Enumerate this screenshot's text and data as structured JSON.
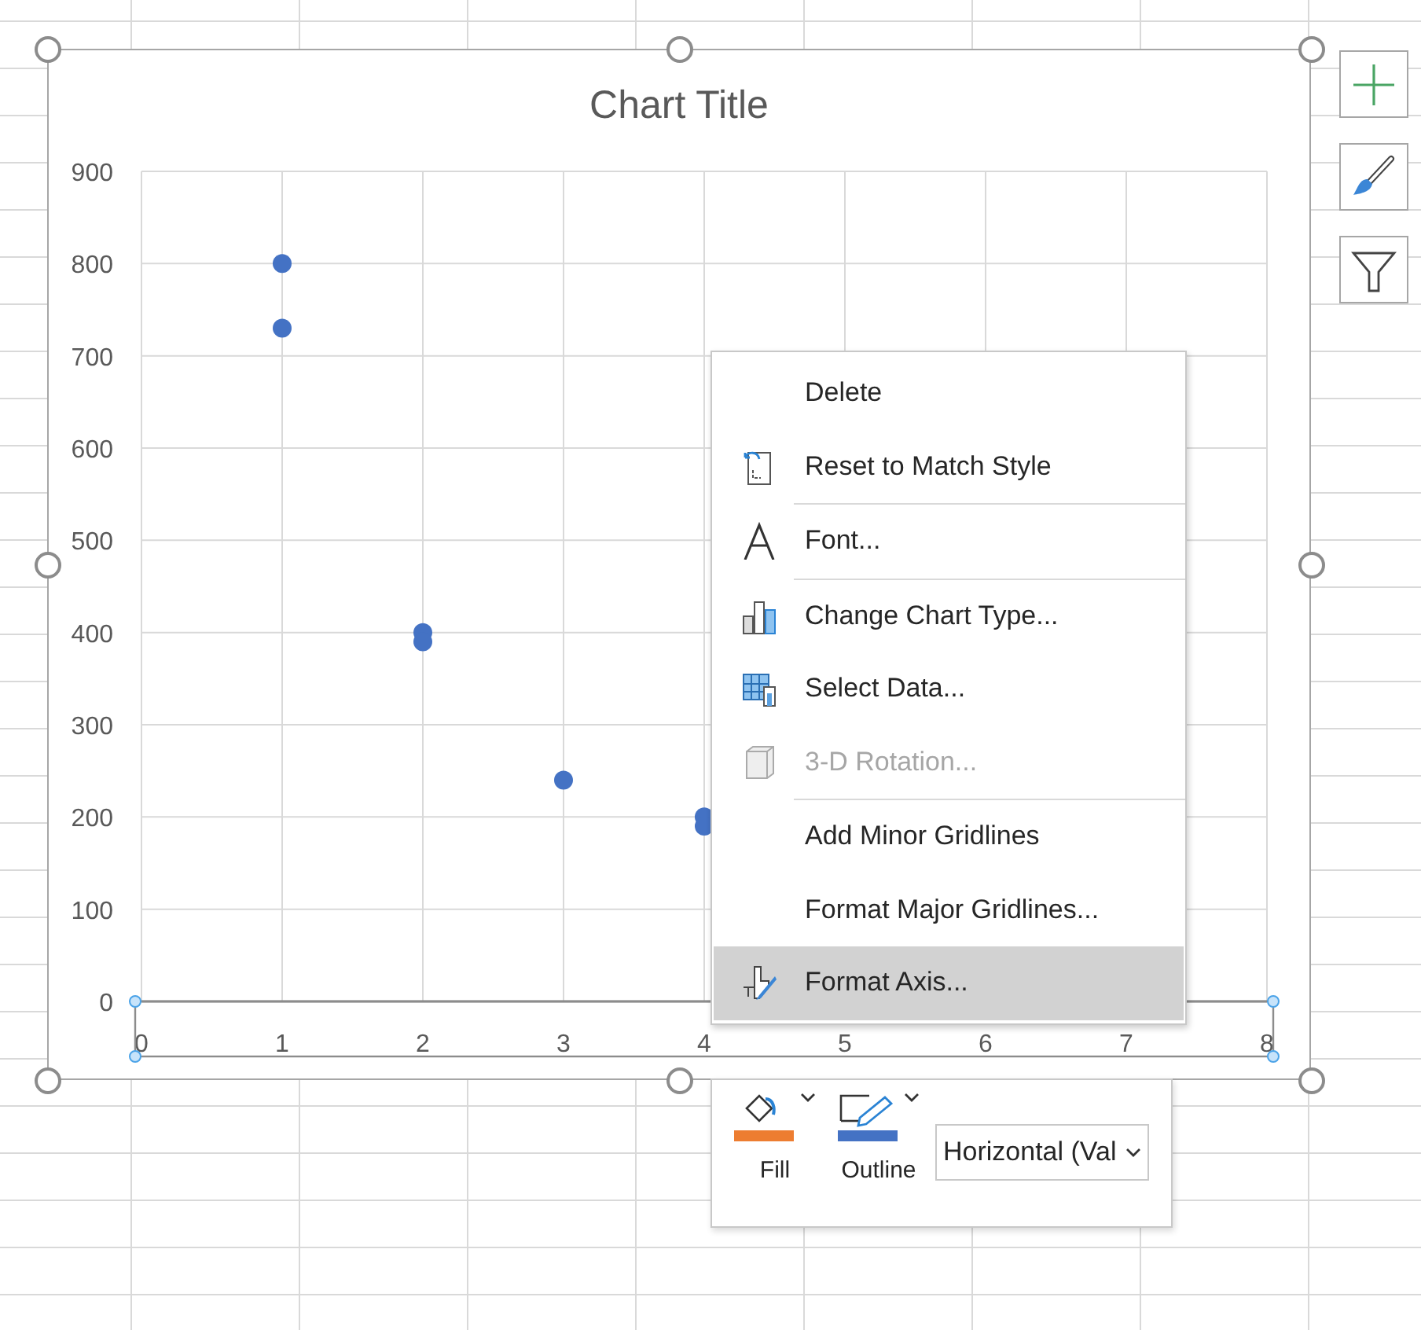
{
  "chart": {
    "title": "Chart Title",
    "chart_data": {
      "type": "scatter",
      "x": [
        1,
        1,
        2,
        2,
        3,
        4,
        4
      ],
      "series": [
        {
          "color": "#4472c4",
          "values": [
            800,
            730,
            400,
            390,
            240,
            200,
            190
          ]
        }
      ],
      "grid": true,
      "xlim": [
        0,
        8
      ],
      "ylim": [
        0,
        900
      ],
      "xticks": [
        0,
        1,
        2,
        3,
        4,
        5,
        6,
        7,
        8
      ],
      "yticks": [
        0,
        100,
        200,
        300,
        400,
        500,
        600,
        700,
        800,
        900
      ]
    },
    "axis_selected": true
  },
  "side_buttons": [
    {
      "kind": "elements"
    },
    {
      "kind": "styles"
    },
    {
      "kind": "filters"
    }
  ],
  "context_menu": {
    "groups": [
      [
        {
          "label": "Delete",
          "disabled": false,
          "selected": false
        },
        {
          "label": "Reset to Match Style",
          "disabled": false,
          "selected": false
        }
      ],
      [
        {
          "label": "Font...",
          "disabled": false,
          "selected": false
        }
      ],
      [
        {
          "label": "Change Chart Type...",
          "disabled": false,
          "selected": false
        },
        {
          "label": "Select Data...",
          "disabled": false,
          "selected": false
        },
        {
          "label": "3-D Rotation...",
          "disabled": true,
          "selected": false
        }
      ],
      [
        {
          "label": "Add Minor Gridlines",
          "disabled": false,
          "selected": false
        },
        {
          "label": "Format Major Gridlines...",
          "disabled": false,
          "selected": false
        },
        {
          "label": "Format Axis...",
          "disabled": false,
          "selected": true
        }
      ]
    ]
  },
  "mini_toolbar": {
    "buttons": [
      {
        "kind": "fill",
        "label": "Fill",
        "color": "#ed7d31"
      },
      {
        "kind": "outline",
        "label": "Outline",
        "color": "#4472c4"
      }
    ],
    "element_dropdown": {
      "value": "Horizontal (Val"
    }
  }
}
